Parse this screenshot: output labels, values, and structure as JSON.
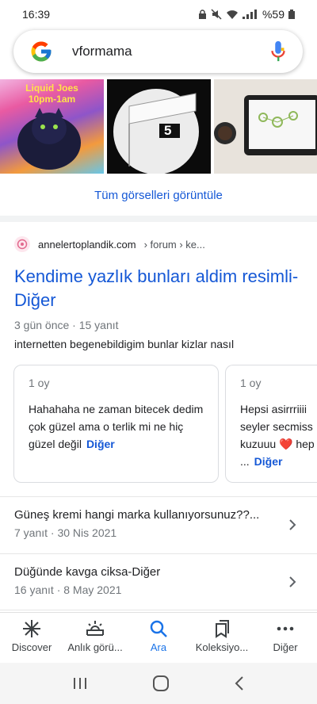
{
  "status_bar": {
    "time": "16:39",
    "battery": "%59"
  },
  "search": {
    "query": "vformama"
  },
  "images": {
    "thumb1_lines": [
      "Liquid Joes",
      "10pm-1am"
    ],
    "thumb2_number": "5",
    "view_all_label": "Tüm görselleri görüntüle"
  },
  "result": {
    "site": "annelertoplandik.com",
    "breadcrumb": "› forum › ke...",
    "title": "Kendime yazlık bunları aldim resimli-Diğer",
    "meta": "3 gün önce · 15 yanıt",
    "snippet": "internetten begenebildigim bunlar kizlar nasıl"
  },
  "answers": [
    {
      "votes": "1 oy",
      "text": "Hahahaha ne zaman bitecek dedim çok güzel ama o terlik mi ne hiç güzel değil",
      "more": "Diğer"
    },
    {
      "votes": "1 oy",
      "text": "Hepsi asirrriiii seyler secmiss kuzuuu ❤️ hep ...",
      "more": "Diğer"
    }
  ],
  "related": [
    {
      "title": "Güneş kremi hangi marka kullanıyorsunuz??...",
      "meta": "7 yanıt · 30 Nis 2021"
    },
    {
      "title": "Düğünde kavga ciksa-Diğer",
      "meta": "16 yanıt · 8 May 2021"
    }
  ],
  "bottom_nav": [
    {
      "label": "Discover",
      "icon": "asterisk-icon"
    },
    {
      "label": "Anlık görü...",
      "icon": "sunrise-icon"
    },
    {
      "label": "Ara",
      "icon": "search-icon"
    },
    {
      "label": "Koleksiyo...",
      "icon": "bookmarks-icon"
    },
    {
      "label": "Diğer",
      "icon": "more-dots-icon"
    }
  ],
  "colors": {
    "link": "#1558d6",
    "active_tab": "#1a73e8"
  }
}
